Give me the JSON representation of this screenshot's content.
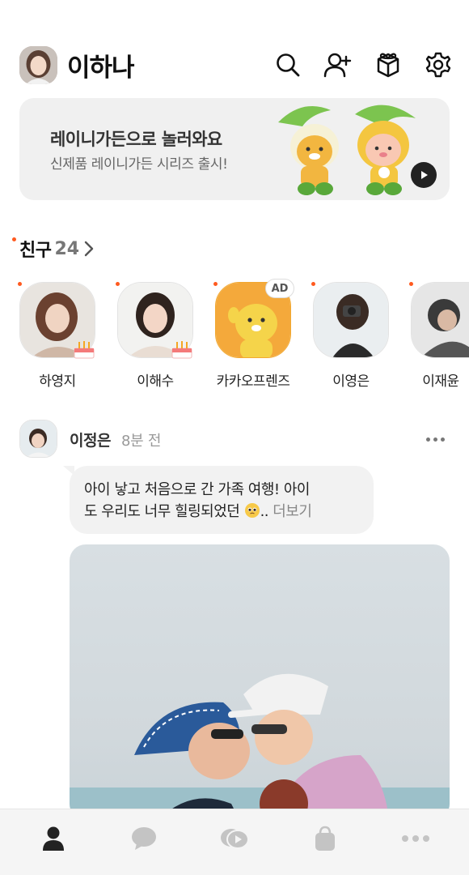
{
  "header": {
    "name": "이하나"
  },
  "banner": {
    "title": "레이니가든으로 놀러와요",
    "subtitle": "신제품 레이니가든 시리즈 출시!"
  },
  "friends": {
    "title": "친구",
    "count": "24",
    "items": [
      {
        "name": "하영지",
        "birthday": true
      },
      {
        "name": "이해수",
        "birthday": true
      },
      {
        "name": "카카오프렌즈",
        "badge": "AD"
      },
      {
        "name": "이영은"
      },
      {
        "name": "이재윤"
      }
    ]
  },
  "post": {
    "author": "이정은",
    "time": "8분 전",
    "text_line1": "아이 낳고 처음으로 간 가족 여행! 아이",
    "text_line2": "도 우리도 너무 힐링되었던",
    "ellipsis": "..",
    "more": "더보기"
  },
  "icons": {
    "header": [
      "search-icon",
      "add-friend-icon",
      "gift-icon",
      "settings-icon"
    ],
    "nav": [
      "friends-icon",
      "chat-icon",
      "openchat-icon",
      "shopping-icon",
      "more-icon"
    ]
  },
  "colors": {
    "accent_dot": "#ff5a1f",
    "active_nav": "#222222",
    "inactive_nav": "#c4c4c4"
  }
}
